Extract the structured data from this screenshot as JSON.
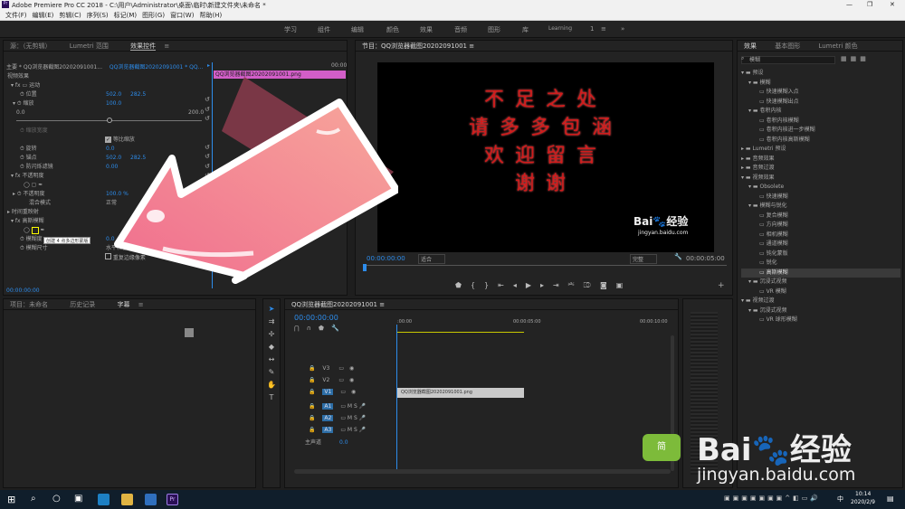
{
  "app": {
    "title": "Adobe Premiere Pro CC 2018 - C:\\用户\\Administrator\\桌面\\临时\\新建文件夹\\未命名 *",
    "win_min": "—",
    "win_max": "❐",
    "win_close": "✕"
  },
  "menu": [
    "文件(F)",
    "编辑(E)",
    "剪辑(C)",
    "序列(S)",
    "标记(M)",
    "图形(G)",
    "窗口(W)",
    "帮助(H)"
  ],
  "workspaces": [
    "学习",
    "组件",
    "编辑",
    "颜色",
    "效果",
    "音频",
    "图形",
    "库",
    "Learning",
    "1",
    "≡",
    "»"
  ],
  "effect_controls": {
    "tabs": [
      "源：（无剪辑）",
      "Lumetri 范围",
      "效果控件",
      "≡"
    ],
    "source": "主要 * QQ浏览器截图20202091001...",
    "clip": "QQ浏览器截图20202091001 * QQ...",
    "ruler_start": "▸",
    "ruler_end": "00:00",
    "clip_bar": "QQ浏览器截图20202091001.png",
    "video_effects": "视频效果",
    "motion": "运动",
    "position": "位置",
    "position_x": "502.0",
    "position_y": "282.5",
    "scale": "缩放",
    "scale_v": "100.0",
    "slider_min": "0.0",
    "slider_max": "200.0",
    "scale_w": "缩放宽度",
    "uniform": "等比缩放",
    "rotation": "旋转",
    "rotation_v": "0.0",
    "anchor": "锚点",
    "anchor_x": "502.0",
    "anchor_y": "282.5",
    "antiflicker": "防闪烁滤镜",
    "antiflicker_v": "0.00",
    "opacity": "不透明度",
    "opacity_inner": "不透明度",
    "opacity_v": "100.0 %",
    "blend": "混合模式",
    "blend_v": "正常",
    "remap": "时间重映射",
    "gaussian": "高斯模糊",
    "blurriness": "模糊度",
    "blur_v": "0.0",
    "blur_dim": "模糊尺寸",
    "blur_dim_v": "水平和垂直",
    "repeat_edge": "重复边缘像素",
    "tooltip": "创建 4 点多边形蒙版",
    "timecode": "00:00:00:00"
  },
  "program": {
    "tab": "节目：QQ浏览器截图20202091001 ≡",
    "lines": [
      "不足之处",
      "请多多包涵",
      "欢迎留言",
      "谢谢"
    ],
    "wm_main": "Bai",
    "wm_paw": "🐾",
    "wm_sub": "经验",
    "wm_url": "jingyan.baidu.com",
    "time_left": "00:00:00:00",
    "fit": "适合",
    "quality": "完整",
    "time_right": "00:00:05:00"
  },
  "project": {
    "tabs": [
      "项目：未命名",
      "历史记录",
      "字幕",
      "≡"
    ]
  },
  "timeline": {
    "tab": "QQ浏览器截图20202091001 ≡",
    "timecode": "00:00:00:00",
    "ruler": [
      ":00:00",
      "00:00:05:00",
      "00:00:10:00"
    ],
    "tracks": [
      "V3",
      "V2",
      "V1",
      "A1",
      "A2",
      "A3"
    ],
    "clip": "QQ浏览器截图20202091001.png",
    "master": "主声道",
    "master_v": "0.0"
  },
  "effects": {
    "tabs": [
      "效果",
      "基本图形",
      "Lumetri 颜色"
    ],
    "search": "模糊",
    "items": [
      "预设",
      "模糊",
      "快速模糊入点",
      "快速模糊出点",
      "卷积内核",
      "卷积内核模糊",
      "卷积内核进一步模糊",
      "卷积内核高斯模糊",
      "Lumetri 预设",
      "音频效果",
      "音频过渡",
      "视频效果",
      "Obsolete",
      "快速模糊",
      "模糊与锐化",
      "复合模糊",
      "方向模糊",
      "相机模糊",
      "通道模糊",
      "钝化蒙版",
      "锐化",
      "高斯模糊",
      "沉浸式视频",
      "VR 模糊",
      "视频过渡",
      "沉浸式视频",
      "VR 球形模糊"
    ]
  },
  "taskbar": {
    "time": "10:14",
    "date": "2020/2/9",
    "lang": "中"
  },
  "overlay": {
    "baidu_big": "Bai",
    "baidu_big2": "经验",
    "baidu_url": "jingyan.baidu.com",
    "mascot": "简"
  }
}
